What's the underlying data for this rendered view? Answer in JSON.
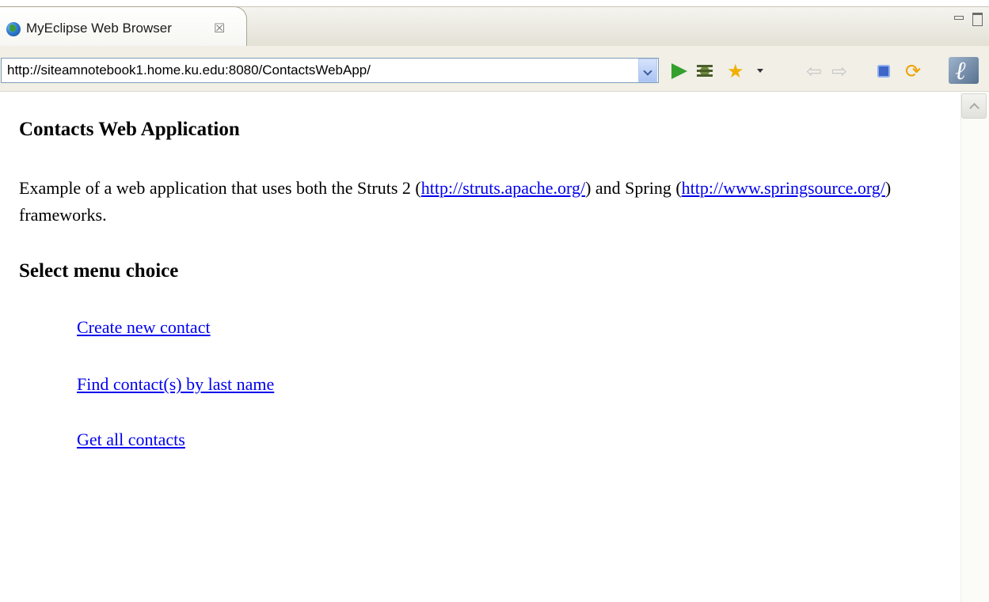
{
  "tab": {
    "title": "MyEclipse Web Browser",
    "close_glyph": "☒"
  },
  "address": {
    "url": "http://siteamnotebook1.home.ku.edu:8080/ContactsWebApp/"
  },
  "toolbar": {
    "icons": [
      "go-icon",
      "debug-icon",
      "add-favorite-icon",
      "back-icon",
      "forward-icon",
      "stop-icon",
      "refresh-icon",
      "myeclipse-logo-icon"
    ],
    "back_glyph": "⇦",
    "forward_glyph": "⇨",
    "favorite_glyph": "★",
    "refresh_glyph": "⟳"
  },
  "page": {
    "heading": "Contacts Web Application",
    "intro_part1": "Example of a web application that uses both the Struts 2 (",
    "struts_link": "http://struts.apache.org/",
    "intro_part2": ") and Spring (",
    "spring_link": "http://www.springsource.org/",
    "intro_part3": ") frameworks.",
    "menu_heading": "Select menu choice",
    "menu": [
      {
        "label": "Create new contact"
      },
      {
        "label": "Find contact(s) by last name"
      },
      {
        "label": "Get all contacts"
      }
    ]
  },
  "colors": {
    "link": "#0000ee",
    "tab_bg": "#f5f4ef",
    "go_green": "#34a02e"
  }
}
